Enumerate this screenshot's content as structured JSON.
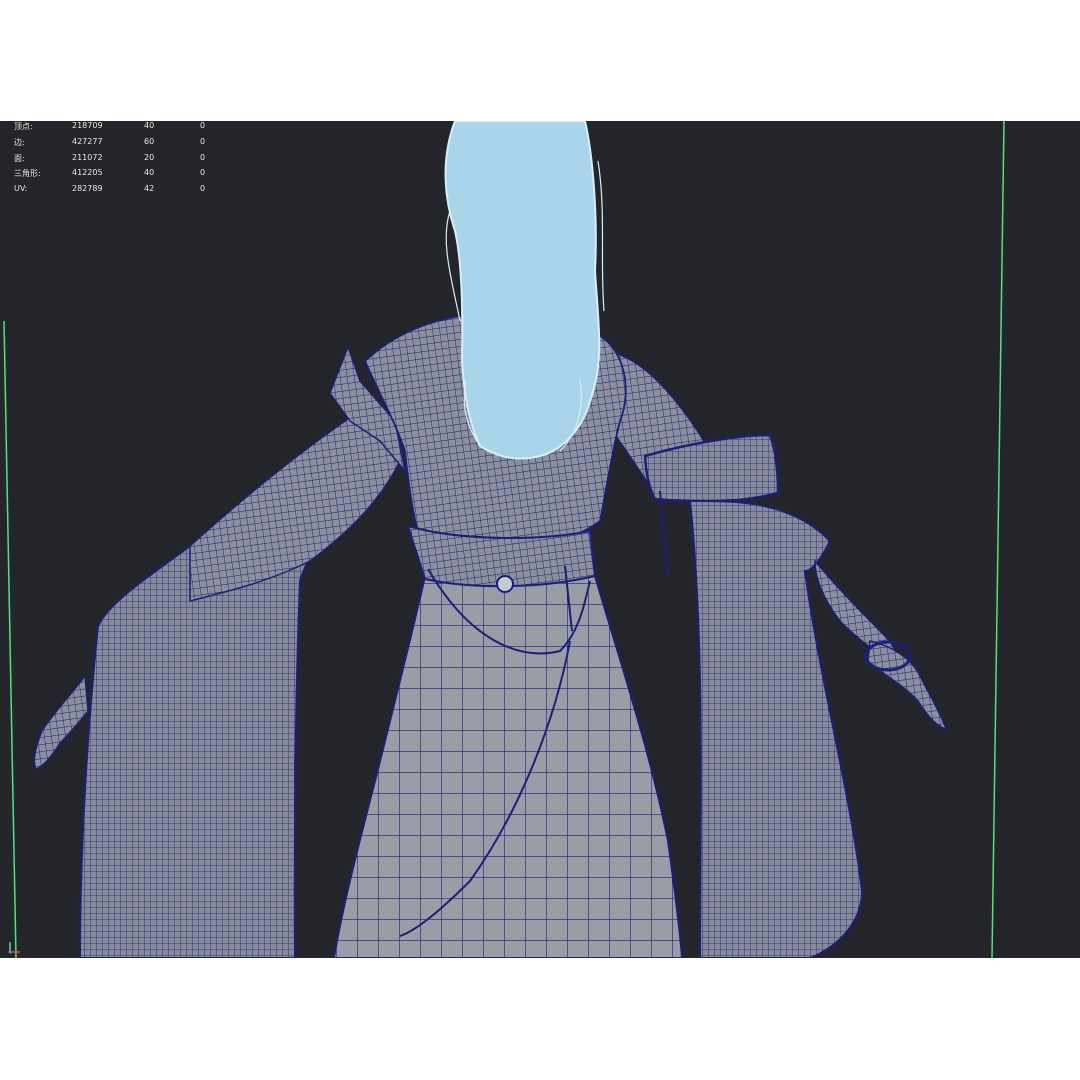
{
  "viewport": {
    "background": "#23252b",
    "statistics": [
      {
        "label": "顶点:",
        "total": "218709",
        "selected": "40",
        "extra": "0"
      },
      {
        "label": "边:",
        "total": "427277",
        "selected": "60",
        "extra": "0"
      },
      {
        "label": "面:",
        "total": "211072",
        "selected": "20",
        "extra": "0"
      },
      {
        "label": "三角形:",
        "total": "412205",
        "selected": "40",
        "extra": "0"
      },
      {
        "label": "UV:",
        "total": "282789",
        "selected": "42",
        "extra": "0"
      }
    ],
    "colors": {
      "mesh_fill": "#8c8f9c",
      "wireframe": "#1c1f78",
      "hair_fill": "#a9d4ea",
      "hair_outline": "#d8eef8",
      "guide_lines": "#55e07a"
    },
    "icons": [
      "axis-gizmo-icon"
    ]
  }
}
